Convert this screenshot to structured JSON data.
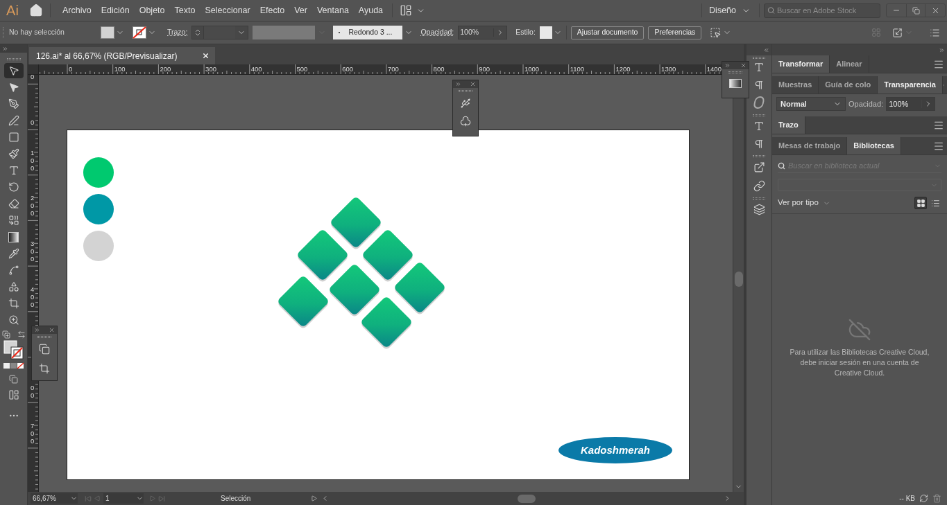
{
  "app": {
    "logo": "Ai"
  },
  "menu": [
    "Archivo",
    "Edición",
    "Objeto",
    "Texto",
    "Seleccionar",
    "Efecto",
    "Ver",
    "Ventana",
    "Ayuda"
  ],
  "workspace": {
    "label": "Diseño"
  },
  "stock_search": {
    "placeholder": "Buscar en Adobe Stock"
  },
  "control_bar": {
    "selection": "No hay selección",
    "stroke_label": "Trazo:",
    "brush": "Redondo 3 ...",
    "opacity_label": "Opacidad:",
    "opacity": "100%",
    "style_label": "Estilo:",
    "buttons": [
      "Ajustar documento",
      "Preferencias"
    ]
  },
  "document_tab": {
    "title": "126.ai* al 66,67% (RGB/Previsualizar)"
  },
  "ruler": {
    "x_labels": [
      "0",
      "100",
      "200",
      "300",
      "400",
      "500",
      "600",
      "700",
      "800",
      "900",
      "1000",
      "1100",
      "1200",
      "1300",
      "1400"
    ],
    "y_labels": [
      "0",
      "0",
      "100",
      "200",
      "300",
      "400",
      "00",
      "700"
    ]
  },
  "tools": [
    {
      "kind": "selection",
      "selected": true
    },
    {
      "kind": "direct",
      "selected": false
    },
    {
      "kind": "pen",
      "selected": false
    },
    {
      "kind": "curvature",
      "selected": false
    },
    {
      "kind": "rectangle",
      "selected": false
    },
    {
      "kind": "brush",
      "selected": false
    },
    {
      "kind": "type",
      "selected": false
    },
    {
      "kind": "rotate",
      "selected": false
    },
    {
      "kind": "eraser",
      "selected": false
    },
    {
      "kind": "shape-builder",
      "selected": false
    },
    {
      "kind": "gradient",
      "selected": false
    },
    {
      "kind": "eyedropper",
      "selected": false
    },
    {
      "kind": "puppet",
      "selected": false
    },
    {
      "kind": "blend",
      "selected": false
    },
    {
      "kind": "artboard",
      "selected": false
    },
    {
      "kind": "zoom",
      "selected": false
    }
  ],
  "artboard": {
    "swatches": [
      {
        "color": "#00c96f"
      },
      {
        "color": "#0098a6"
      },
      {
        "color": "#d3d3d3"
      }
    ],
    "logo_text": "Kadoshmerah"
  },
  "status_bar": {
    "zoom": "66,67%",
    "artboard": "1",
    "tool": "Selección"
  },
  "panels": {
    "transform_tabs": [
      {
        "label": "Transformar",
        "selected": true
      },
      {
        "label": "Alinear",
        "selected": false
      }
    ],
    "color_tabs": [
      {
        "label": "Muestras",
        "selected": false
      },
      {
        "label": "Guía de colo",
        "selected": false
      },
      {
        "label": "Transparencia",
        "selected": true
      }
    ],
    "blend_mode": "Normal",
    "opacity_label": "Opacidad:",
    "opacity": "100%",
    "stroke_tabs": [
      {
        "label": "Trazo",
        "selected": true
      }
    ],
    "library_tabs": [
      {
        "label": "Mesas de trabajo",
        "selected": false
      },
      {
        "label": "Bibliotecas",
        "selected": true
      }
    ],
    "library_search": {
      "placeholder": "Buscar en biblioteca actual"
    },
    "view_by": "Ver por tipo",
    "view_buttons": [
      {
        "kind": "grid",
        "selected": true
      },
      {
        "kind": "list",
        "selected": false
      }
    ],
    "message": "Para utilizar las Bibliotecas Creative Cloud, debe iniciar sesión en una cuenta de Creative Cloud.",
    "size": "-- KB"
  }
}
